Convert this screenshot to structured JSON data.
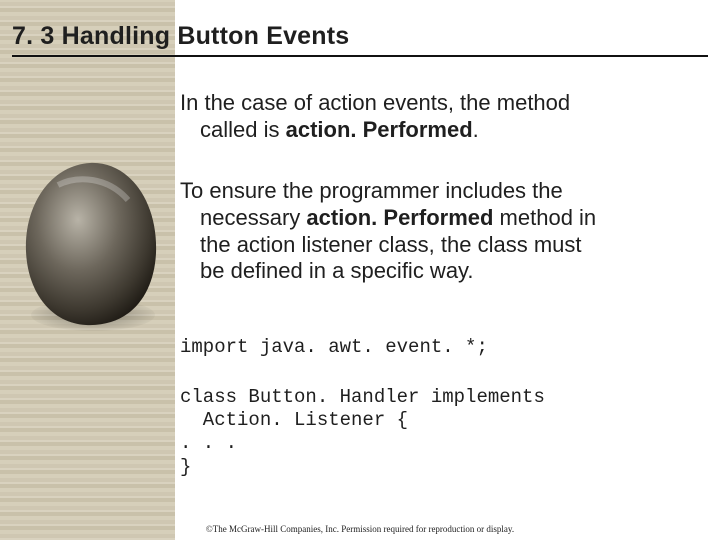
{
  "title": "7. 3 Handling Button Events",
  "para1_a": "In the case of action events, the method",
  "para1_b_pre": "called is ",
  "para1_b_bold": "action. Performed",
  "para1_b_post": ".",
  "para2_a": "To ensure the programmer includes the",
  "para2_b_pre": "necessary ",
  "para2_b_bold": "action. Performed",
  "para2_b_post": " method in",
  "para2_c": "the action listener class, the class must",
  "para2_d": "be defined in a specific way.",
  "code_import": "import java. awt. event. *;",
  "code_block": "class Button. Handler implements\n  Action. Listener {\n. . .\n}",
  "footer": "©The McGraw-Hill Companies, Inc. Permission required for reproduction or display."
}
